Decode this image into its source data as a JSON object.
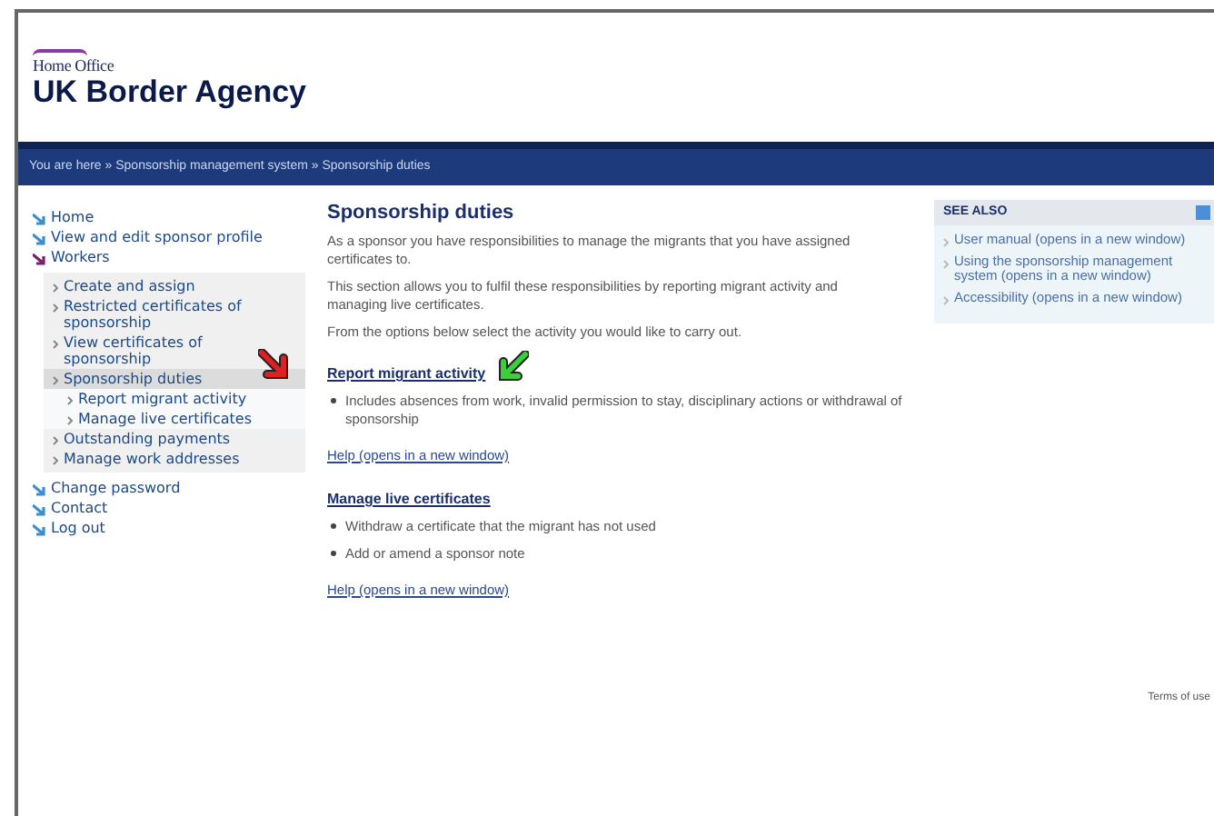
{
  "header": {
    "org": "Home Office",
    "title": "UK Border Agency"
  },
  "breadcrumb": "You are here » Sponsorship management system » Sponsorship duties",
  "nav": [
    {
      "label": "Home",
      "expanded": false,
      "selected": false
    },
    {
      "label": "View and edit sponsor profile",
      "expanded": false,
      "selected": false
    },
    {
      "label": "Workers",
      "expanded": true,
      "selected": false,
      "children": [
        {
          "label": "Create and assign",
          "selected": false
        },
        {
          "label": "Restricted certificates of sponsorship",
          "selected": false
        },
        {
          "label": "View certificates of sponsorship",
          "selected": false
        },
        {
          "label": "Sponsorship duties",
          "selected": true,
          "children": [
            {
              "label": "Report migrant activity",
              "selected": false
            },
            {
              "label": "Manage live certificates",
              "selected": false
            }
          ]
        },
        {
          "label": "Outstanding payments",
          "selected": false
        },
        {
          "label": "Manage work addresses",
          "selected": false
        }
      ]
    },
    {
      "label": "Change password",
      "expanded": false,
      "selected": false
    },
    {
      "label": "Contact",
      "expanded": false,
      "selected": false
    },
    {
      "label": "Log out",
      "expanded": false,
      "selected": false
    }
  ],
  "main": {
    "title": "Sponsorship duties",
    "paragraphs": [
      "As a sponsor you have responsibilities to manage the migrants that you have assigned certificates to.",
      "This section allows you to fulfil these responsibilities by reporting migrant activity and managing live certificates.",
      "From the options below select the activity you would like to carry out."
    ],
    "sections": [
      {
        "link": "Report migrant activity",
        "bullets": [
          "Includes absences from work, invalid permission to stay, disciplinary actions or withdrawal of sponsorship"
        ],
        "help": "Help (opens in a new window)"
      },
      {
        "link": "Manage live certificates",
        "bullets": [
          "Withdraw a certificate that the migrant has not used",
          "Add or amend a sponsor note"
        ],
        "help": "Help (opens in a new window)"
      }
    ]
  },
  "see_also": {
    "title": "SEE ALSO",
    "links": [
      "User manual (opens in a new window)",
      "Using the sponsorship management system (opens in a new window)",
      "Accessibility (opens in a new window)"
    ]
  },
  "footer": {
    "link": "Terms of use"
  }
}
